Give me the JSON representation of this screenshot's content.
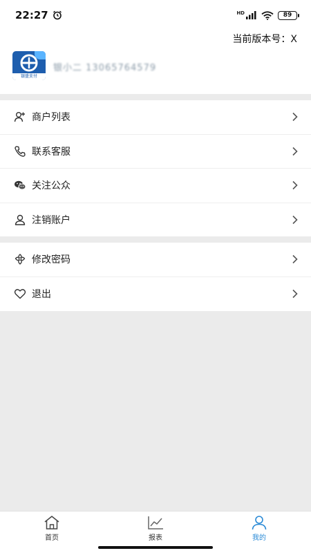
{
  "status_bar": {
    "time": "22:27",
    "battery": "89",
    "network": "HD"
  },
  "header": {
    "version_label": "当前版本号：X",
    "logo_text": "银盛支付",
    "user_info": "银小二 13065764579"
  },
  "menu_group_1": [
    {
      "label": "商户列表",
      "icon": "user-add-icon"
    },
    {
      "label": "联系客服",
      "icon": "phone-icon"
    },
    {
      "label": "关注公众",
      "icon": "wechat-icon"
    },
    {
      "label": "注销账户",
      "icon": "user-icon"
    }
  ],
  "menu_group_2": [
    {
      "label": "修改密码",
      "icon": "flower-icon"
    },
    {
      "label": "退出",
      "icon": "heart-icon"
    }
  ],
  "tabbar": {
    "items": [
      {
        "label": "首页",
        "icon": "home-icon",
        "active": false
      },
      {
        "label": "报表",
        "icon": "chart-icon",
        "active": false
      },
      {
        "label": "我的",
        "icon": "profile-icon",
        "active": true
      }
    ],
    "active_color": "#2a8ad6"
  }
}
